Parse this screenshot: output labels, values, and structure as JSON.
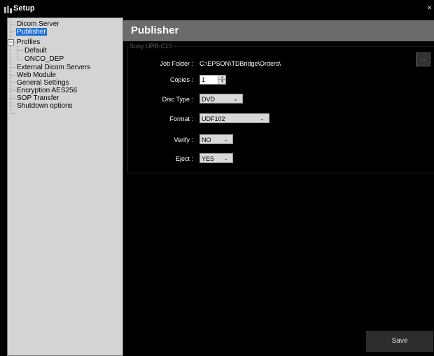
{
  "window": {
    "title": "Setup",
    "close_glyph": "×",
    "icon": "setup-app-icon"
  },
  "tree": {
    "items": [
      {
        "label": "Dicom Server"
      },
      {
        "label": "Publisher"
      },
      {
        "label": "Profiles"
      },
      {
        "label": "Default"
      },
      {
        "label": "ONCO_DEP"
      },
      {
        "label": "External Dicom Servers"
      },
      {
        "label": "Web Module"
      },
      {
        "label": "General Settings"
      },
      {
        "label": "Encryption AES256"
      },
      {
        "label": "SOP Transfer"
      },
      {
        "label": "Shutdown options"
      }
    ],
    "selected": "Publisher",
    "expander_glyph": "−"
  },
  "panel": {
    "title": "Publisher",
    "group_legend": "Sony UPB-C10",
    "job_folder_label": "Job Folder :",
    "job_folder_value": "C:\\EPSON\\TDBridge\\Orders\\",
    "browse_label": "...",
    "copies_label": "Copies :",
    "copies_value": "1",
    "disc_type_label": "Disc Type :",
    "disc_type_value": "DVD",
    "format_label": "Format :",
    "format_value": "UDF102",
    "verify_label": "Verify :",
    "verify_value": "NO",
    "eject_label": "Eject :",
    "eject_value": "YES",
    "save_label": "Save"
  },
  "colors": {
    "selection": "#1f6fd6",
    "header": "#6b6b6b",
    "tree_bg": "#d4d4d4"
  }
}
